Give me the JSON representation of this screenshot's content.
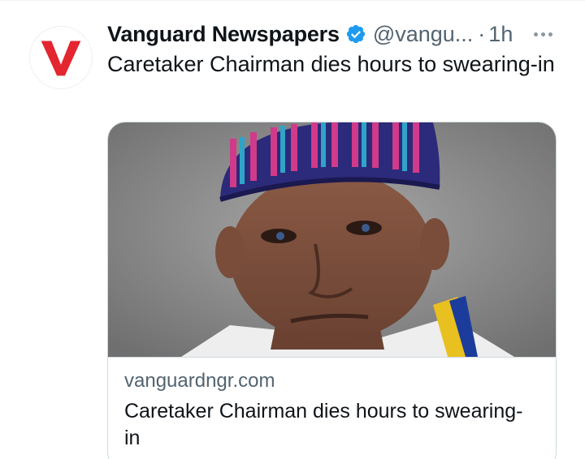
{
  "tweet": {
    "author_name": "Vanguard Newspapers",
    "handle": "@vangu...",
    "separator": "·",
    "time": "1h",
    "text": "Caretaker Chairman dies hours to swearing-in",
    "avatar_letter": "V",
    "verified_icon": "verified-badge-icon",
    "more_icon": "more-options-icon"
  },
  "card": {
    "domain": "vanguardngr.com",
    "title": "Caretaker Chairman dies hours to swearing-in",
    "image_icon": "portrait-photo"
  },
  "colors": {
    "brand_red": "#e3262f",
    "verified_blue": "#1d9bf0",
    "secondary_text": "#536471",
    "primary_text": "#0f1419",
    "border": "#cfd9de"
  }
}
